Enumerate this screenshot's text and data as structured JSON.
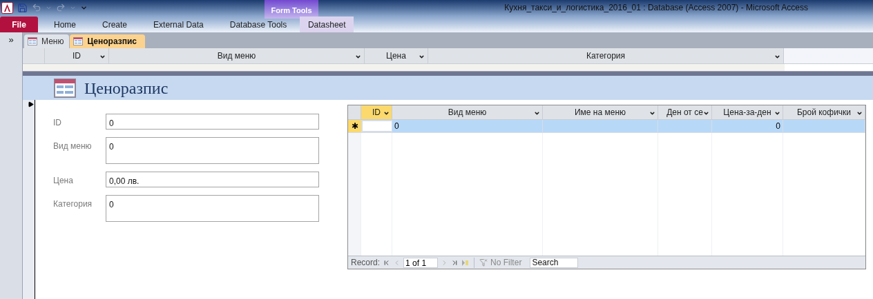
{
  "window": {
    "title": "Кухня_такси_и_логистика_2016_01 : Database (Access 2007)  -  Microsoft Access"
  },
  "ribbon": {
    "contextual_header": "Form Tools",
    "tabs": [
      {
        "label": "File",
        "kind": "file",
        "selected": false
      },
      {
        "label": "Home",
        "kind": "plain",
        "selected": false
      },
      {
        "label": "Create",
        "kind": "plain",
        "selected": false
      },
      {
        "label": "External Data",
        "kind": "plain",
        "selected": false
      },
      {
        "label": "Database Tools",
        "kind": "plain",
        "selected": false
      },
      {
        "label": "Datasheet",
        "kind": "contextual",
        "selected": false
      }
    ]
  },
  "nav_pane": {
    "expand_glyph": "»"
  },
  "document_tabs": [
    {
      "label": "Меню",
      "selected": false
    },
    {
      "label": "Ценоразпис",
      "selected": true
    }
  ],
  "main_datasheet": {
    "columns": [
      "ID",
      "Вид меню",
      "Цена",
      "Категория"
    ]
  },
  "form": {
    "title": "Ценоразпис",
    "fields": [
      {
        "label": "ID",
        "value": "0",
        "tall": false
      },
      {
        "label": "Вид меню",
        "value": "0",
        "tall": true
      },
      {
        "label": "Цена",
        "value": "0,00 лв.",
        "tall": false
      },
      {
        "label": "Категория",
        "value": "0",
        "tall": true
      }
    ]
  },
  "subform": {
    "columns": [
      {
        "label": "ID",
        "sorted": true
      },
      {
        "label": "Вид меню",
        "sorted": false
      },
      {
        "label": "Име на меню",
        "sorted": false
      },
      {
        "label": "Ден от се",
        "sorted": false
      },
      {
        "label": "Цена-за-ден",
        "sorted": false
      },
      {
        "label": "Брой кофички",
        "sorted": false
      }
    ],
    "new_row": {
      "marker": "✱",
      "cells": [
        {
          "focused": true
        },
        {
          "value": "0",
          "numeric": false,
          "focused": false
        },
        {
          "focused": false
        },
        {
          "focused": false
        },
        {
          "value": "0",
          "numeric": true,
          "focused": false
        },
        {
          "focused": false
        }
      ]
    },
    "navigation": {
      "label": "Record:",
      "position": "1 of 1",
      "filter": "No Filter",
      "search_placeholder": "Search"
    }
  }
}
